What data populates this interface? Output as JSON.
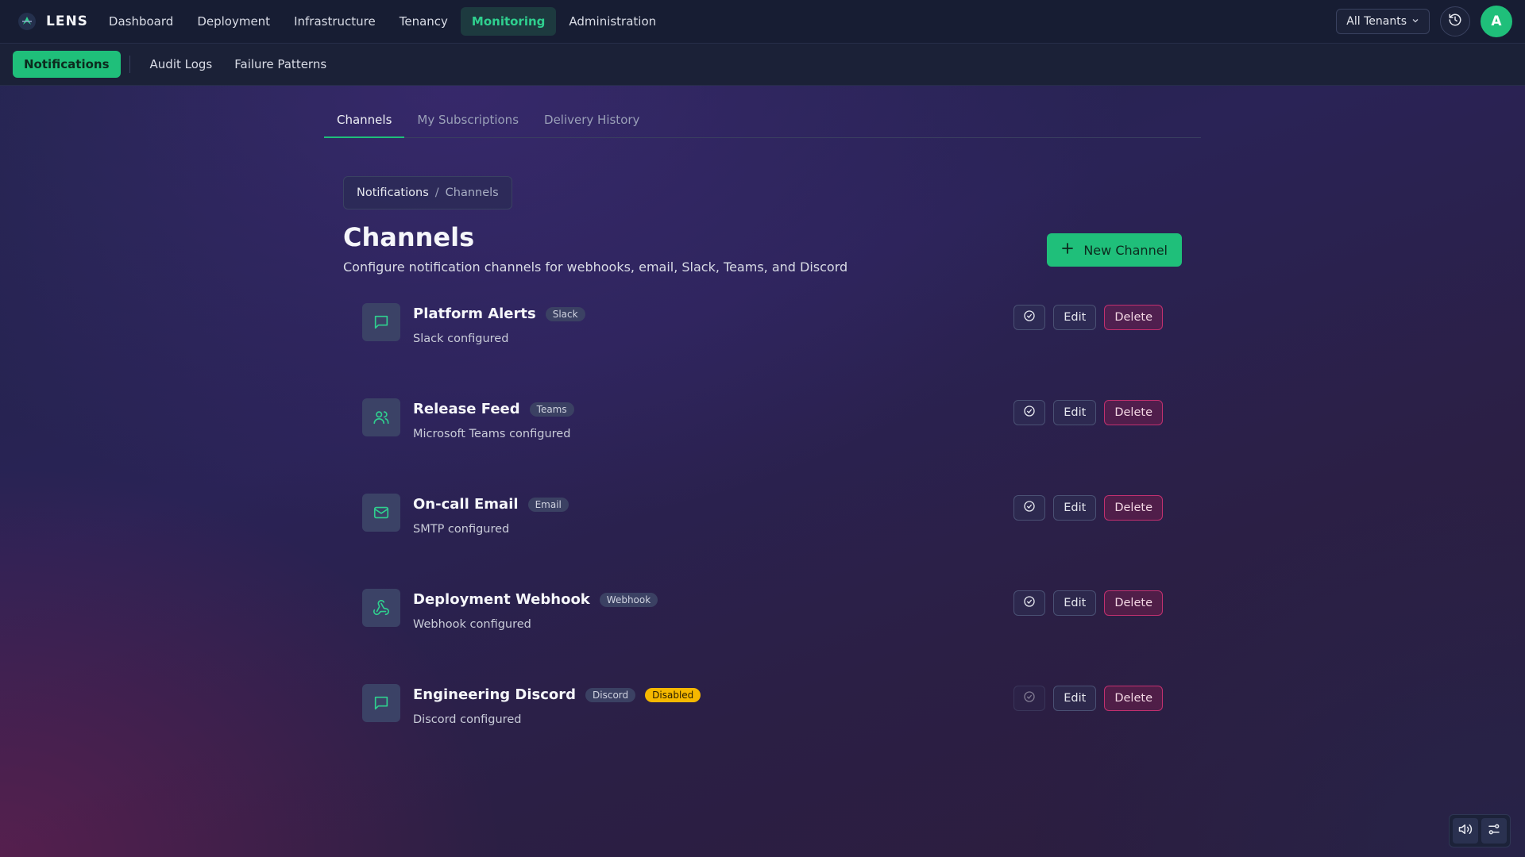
{
  "brand": {
    "name": "LENS"
  },
  "nav": {
    "items": [
      {
        "label": "Dashboard",
        "active": false
      },
      {
        "label": "Deployment",
        "active": false
      },
      {
        "label": "Infrastructure",
        "active": false
      },
      {
        "label": "Tenancy",
        "active": false
      },
      {
        "label": "Monitoring",
        "active": true
      },
      {
        "label": "Administration",
        "active": false
      }
    ],
    "tenant_label": "All Tenants",
    "avatar_initial": "A"
  },
  "subnav": {
    "items": [
      {
        "label": "Notifications",
        "active": true
      },
      {
        "label": "Audit Logs",
        "active": false
      },
      {
        "label": "Failure Patterns",
        "active": false
      }
    ]
  },
  "tabs": [
    {
      "label": "Channels",
      "active": true
    },
    {
      "label": "My Subscriptions",
      "active": false
    },
    {
      "label": "Delivery History",
      "active": false
    }
  ],
  "breadcrumb": {
    "parent": "Notifications",
    "separator": "/",
    "current": "Channels"
  },
  "page": {
    "title": "Channels",
    "subtitle": "Configure notification channels for webhooks, email, Slack, Teams, and Discord",
    "new_button": "New Channel"
  },
  "channels": [
    {
      "name": "Platform Alerts",
      "type": "Slack",
      "description": "Slack configured",
      "icon": "message-square-icon",
      "disabled": false
    },
    {
      "name": "Release Feed",
      "type": "Teams",
      "description": "Microsoft Teams configured",
      "icon": "users-icon",
      "disabled": false
    },
    {
      "name": "On-call Email",
      "type": "Email",
      "description": "SMTP configured",
      "icon": "mail-icon",
      "disabled": false
    },
    {
      "name": "Deployment Webhook",
      "type": "Webhook",
      "description": "Webhook configured",
      "icon": "webhook-icon",
      "disabled": false
    },
    {
      "name": "Engineering Discord",
      "type": "Discord",
      "description": "Discord configured",
      "icon": "message-square-icon",
      "disabled": true,
      "status_badge": "Disabled"
    }
  ],
  "actions": {
    "edit": "Edit",
    "delete": "Delete"
  },
  "colors": {
    "accent": "#1fbf7a",
    "danger": "#c2306f",
    "warning": "#f5b800",
    "topbar": "#171d33"
  }
}
